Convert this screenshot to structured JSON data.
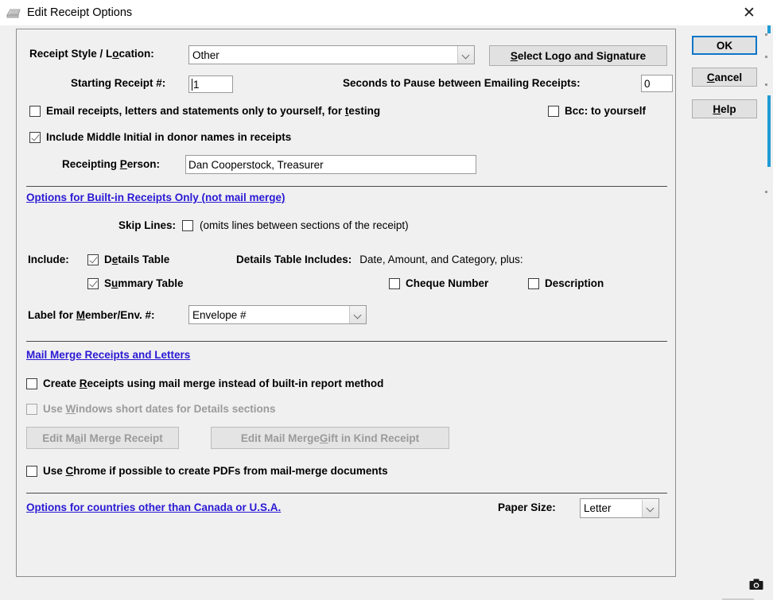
{
  "window": {
    "title": "Edit Receipt Options",
    "icon": "typewriter-icon",
    "close_label": "✕"
  },
  "action_buttons": {
    "ok": "OK",
    "cancel_prefix": "C",
    "cancel_rest": "ancel",
    "help_prefix": "H",
    "help_rest": "elp"
  },
  "top_section": {
    "style_label_a": "Receipt Style / L",
    "style_label_b": "o",
    "style_label_c": "cation:",
    "style_value": "Other",
    "select_logo_prefix": "S",
    "select_logo_rest": "elect Logo and Signature",
    "starting_receipt_label": "Starting Receipt #:",
    "starting_receipt_value": "1",
    "seconds_label": "Seconds to Pause between Emailing Receipts:",
    "seconds_value": "0",
    "email_testing_a": "Email receipts, letters and statements only to yourself, for ",
    "email_testing_b": "t",
    "email_testing_c": "esting",
    "email_testing_checked": false,
    "bcc_a": "Bcc: to yourself",
    "bcc_checked": false,
    "middle_initial_label": "Include Middle Initial in donor names in receipts",
    "middle_initial_checked": true,
    "receipting_person_a": "Receipting ",
    "receipting_person_b": "P",
    "receipting_person_c": "erson:",
    "receipting_person_value": "Dan Cooperstock, Treasurer"
  },
  "builtin_section": {
    "heading": "Options for Built-in Receipts Only (not mail merge)",
    "skip_lines_label": "Skip Lines:",
    "skip_lines_checked": false,
    "skip_lines_note": "(omits lines between sections of the receipt)",
    "include_label": "Include:",
    "details_table_a": "D",
    "details_table_b": "e",
    "details_table_c": "tails Table",
    "details_table_checked": true,
    "summary_table_a": "S",
    "summary_table_b": "u",
    "summary_table_c": "mmary Table",
    "summary_table_checked": true,
    "details_includes_label": "Details Table Includes:",
    "details_includes_value": "Date, Amount, and Category, plus:",
    "cheque_number_label": "Cheque Number",
    "cheque_number_checked": false,
    "description_label": "Description",
    "description_checked": false,
    "label_member_a": "Label for ",
    "label_member_b": "M",
    "label_member_c": "ember/Env. #:",
    "label_member_value": "Envelope #"
  },
  "mailmerge_section": {
    "heading": "Mail Merge Receipts and Letters",
    "create_receipts_a": "Create ",
    "create_receipts_b": "R",
    "create_receipts_c": "eceipts using mail merge instead of built-in report method",
    "create_receipts_checked": false,
    "short_dates_a": "Use ",
    "short_dates_b": "W",
    "short_dates_c": "indows short dates for Details sections",
    "short_dates_checked": false,
    "short_dates_disabled": true,
    "edit_receipt_a": "Edit M",
    "edit_receipt_b": "a",
    "edit_receipt_c": "il Merge Receipt",
    "edit_receipt_disabled": true,
    "edit_gik_a": "Edit Mail Merge ",
    "edit_gik_b": "G",
    "edit_gik_c": "ift in Kind Receipt",
    "edit_gik_disabled": true,
    "use_chrome_a": "Use ",
    "use_chrome_b": "C",
    "use_chrome_c": "hrome if possible to create PDFs from mail-merge documents",
    "use_chrome_checked": false
  },
  "bottom_section": {
    "countries_link": "Options for countries other than Canada or U.S.A.",
    "paper_size_label": "Paper Size:",
    "paper_size_value": "Letter"
  },
  "overlay": {
    "camera_icon": "camera-icon"
  },
  "colors": {
    "link": "#2a19d4",
    "focus_border": "#0d76c8",
    "accent_edge": "#1e9bd4",
    "dialog_bg": "#f0f0f0"
  }
}
